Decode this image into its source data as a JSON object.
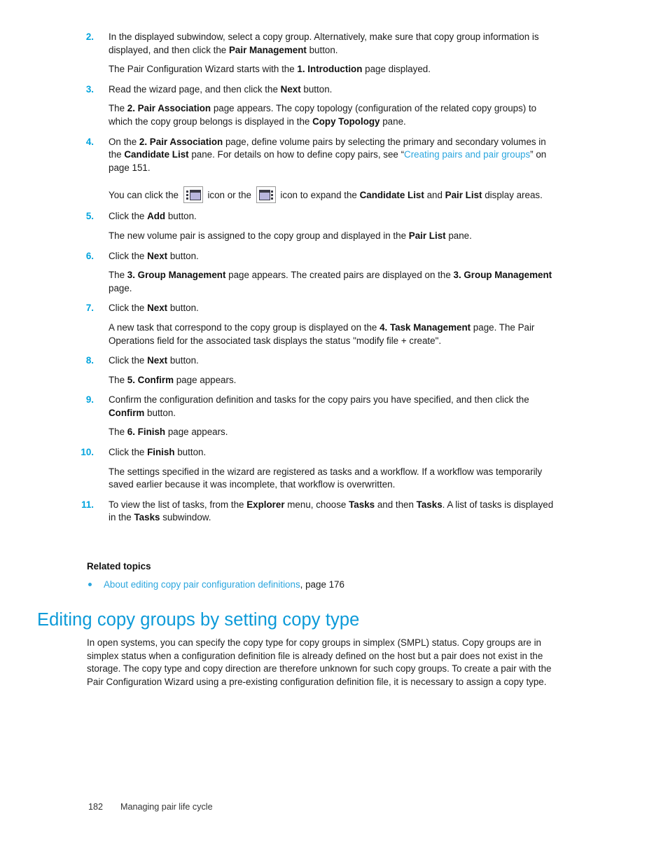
{
  "colors": {
    "accent": "#00a3dd",
    "heading": "#0c9ad8",
    "link": "#2ba6de",
    "text": "#1d1d1d"
  },
  "steps": [
    {
      "num": "2.",
      "body_pre": "In the displayed subwindow, select a copy group. Alternatively, make sure that copy group information is displayed, and then click the ",
      "body_bold": "Pair Management",
      "body_post": " button.",
      "follow_pre": "The Pair Configuration Wizard starts with the ",
      "follow_bold": "1. Introduction",
      "follow_post": " page displayed."
    },
    {
      "num": "3.",
      "body_pre": "Read the wizard page, and then click the ",
      "body_bold": "Next",
      "body_post": " button.",
      "follow_pre": "The ",
      "follow_bold": "2. Pair Association",
      "follow_mid": " page appears. The copy topology (configuration of the related copy groups) to which the copy group belongs is displayed in the ",
      "follow_bold2": "Copy Topology",
      "follow_post": " pane."
    },
    {
      "num": "4.",
      "p1": "On the ",
      "b1": "2. Pair Association",
      "p2": " page, define volume pairs by selecting the primary and secondary volumes in the ",
      "b2": "Candidate List",
      "p3": " pane. For details on how to define copy pairs, see “",
      "link": "Creating pairs and pair groups",
      "p4": "” on page 151.",
      "icon_p1": "You can click the ",
      "icon_p2": " icon or the ",
      "icon_p3": " icon to expand the ",
      "icon_b1": "Candidate List",
      "icon_p4": " and ",
      "icon_b2": "Pair List",
      "icon_p5": " display areas."
    },
    {
      "num": "5.",
      "body_pre": "Click the ",
      "body_bold": "Add",
      "body_post": " button.",
      "follow_pre": "The new volume pair is assigned to the copy group and displayed in the ",
      "follow_bold": "Pair List",
      "follow_post": " pane."
    },
    {
      "num": "6.",
      "body_pre": "Click the ",
      "body_bold": "Next",
      "body_post": " button.",
      "follow_pre": "The ",
      "follow_bold": "3. Group Management",
      "follow_mid": " page appears. The created pairs are displayed on the ",
      "follow_bold2": "3. Group Management",
      "follow_post": " page."
    },
    {
      "num": "7.",
      "body_pre": "Click the ",
      "body_bold": "Next",
      "body_post": " button.",
      "follow_pre": "A new task that correspond to the copy group is displayed on the ",
      "follow_bold": "4. Task Management",
      "follow_post": " page. The Pair Operations field for the associated task displays the status \"modify file + create\"."
    },
    {
      "num": "8.",
      "body_pre": "Click the ",
      "body_bold": "Next",
      "body_post": " button.",
      "follow_pre": "The ",
      "follow_bold": "5. Confirm",
      "follow_post": " page appears."
    },
    {
      "num": "9.",
      "body_pre": "Confirm the configuration definition and tasks for the copy pairs you have specified, and then click the ",
      "body_bold": "Confirm",
      "body_post": " button.",
      "follow_pre": "The ",
      "follow_bold": "6. Finish",
      "follow_post": " page appears."
    },
    {
      "num": "10.",
      "body_pre": "Click the ",
      "body_bold": "Finish",
      "body_post": " button.",
      "follow_pre": "The settings specified in the wizard are registered as tasks and a workflow. If a workflow was temporarily saved earlier because it was incomplete, that workflow is overwritten."
    },
    {
      "num": "11.",
      "p1": "To view the list of tasks, from the ",
      "b1": "Explorer",
      "p2": " menu, choose ",
      "b2": "Tasks",
      "p3": " and then ",
      "b3": "Tasks",
      "p4": ". A list of tasks is displayed in the ",
      "b4": "Tasks",
      "p5": " subwindow."
    }
  ],
  "related": {
    "heading": "Related topics",
    "items": [
      {
        "link": "About editing copy pair configuration definitions",
        "suffix": ", page 176"
      }
    ]
  },
  "section": {
    "heading": "Editing copy groups by setting copy type",
    "paragraph": "In open systems, you can specify the copy type for copy groups in simplex (SMPL) status. Copy groups are in simplex status when a configuration definition file is already defined on the host but a pair does not exist in the storage.  The copy type and copy direction are therefore unknown for such copy groups. To create a pair with the Pair Configuration Wizard using a pre-existing configuration definition file, it is necessary to assign a copy type."
  },
  "footer": {
    "page_number": "182",
    "chapter": "Managing pair life cycle"
  },
  "icons": {
    "expand_left": "expand-left-icon",
    "expand_right": "expand-right-icon"
  }
}
